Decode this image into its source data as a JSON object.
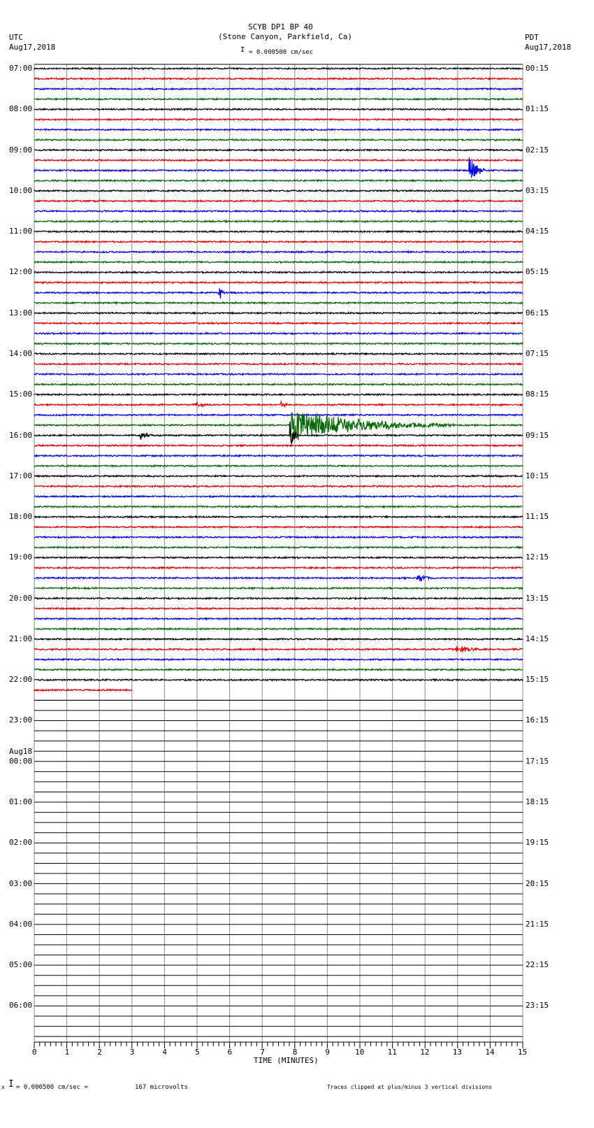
{
  "header": {
    "title": "SCYB DP1 BP 40",
    "subtitle": "(Stone Canyon, Parkfield, Ca)",
    "left_tz": "UTC",
    "left_date": "Aug17,2018",
    "right_tz": "PDT",
    "right_date": "Aug17,2018",
    "scale": "= 0.000500 cm/sec"
  },
  "footer": {
    "scale": "= 0.000500 cm/sec =",
    "microvolts": "167 microvolts",
    "clip_note": "Traces clipped at plus/minus 3 vertical divisions",
    "marker": "x"
  },
  "chart_data": {
    "type": "line",
    "title": "SCYB DP1 BP 40",
    "xlabel": "TIME (MINUTES)",
    "xlim": [
      0,
      15
    ],
    "x_ticks": [
      "0",
      "1",
      "2",
      "3",
      "4",
      "5",
      "6",
      "7",
      "8",
      "9",
      "10",
      "11",
      "12",
      "13",
      "14",
      "15"
    ],
    "left_labels": [
      "07:00",
      "08:00",
      "09:00",
      "10:00",
      "11:00",
      "12:00",
      "13:00",
      "14:00",
      "15:00",
      "16:00",
      "17:00",
      "18:00",
      "19:00",
      "20:00",
      "21:00",
      "22:00",
      "23:00",
      "00:00",
      "01:00",
      "02:00",
      "03:00",
      "04:00",
      "05:00",
      "06:00"
    ],
    "day_change_label": "Aug18",
    "right_labels": [
      "00:15",
      "01:15",
      "02:15",
      "03:15",
      "04:15",
      "05:15",
      "06:15",
      "07:15",
      "08:15",
      "09:15",
      "10:15",
      "11:15",
      "12:15",
      "13:15",
      "14:15",
      "15:15",
      "16:15",
      "17:15",
      "18:15",
      "19:15",
      "20:15",
      "21:15",
      "22:15",
      "23:15"
    ],
    "rows_total": 96,
    "rows_with_data": 61,
    "last_row_end_minute": 3,
    "trace_colors": [
      "#000000",
      "#dd0000",
      "#0000dd",
      "#006600"
    ],
    "events": [
      {
        "row": 10,
        "minute": 13.4,
        "amplitude": 3,
        "duration": 0.4
      },
      {
        "row": 22,
        "minute": 5.7,
        "amplitude": 1.2,
        "duration": 0.15
      },
      {
        "row": 33,
        "minute": 5.0,
        "amplitude": 0.4,
        "duration": 0.3
      },
      {
        "row": 33,
        "minute": 7.6,
        "amplitude": 0.5,
        "duration": 0.3
      },
      {
        "row": 35,
        "minute": 7.9,
        "amplitude": 3,
        "duration": 5
      },
      {
        "row": 36,
        "minute": 3.3,
        "amplitude": 0.8,
        "duration": 0.3
      },
      {
        "row": 36,
        "minute": 7.9,
        "amplitude": 2.5,
        "duration": 0.2
      },
      {
        "row": 50,
        "minute": 11.8,
        "amplitude": 0.8,
        "duration": 0.4
      },
      {
        "row": 57,
        "minute": 13.0,
        "amplitude": 0.6,
        "duration": 1.0
      }
    ]
  }
}
